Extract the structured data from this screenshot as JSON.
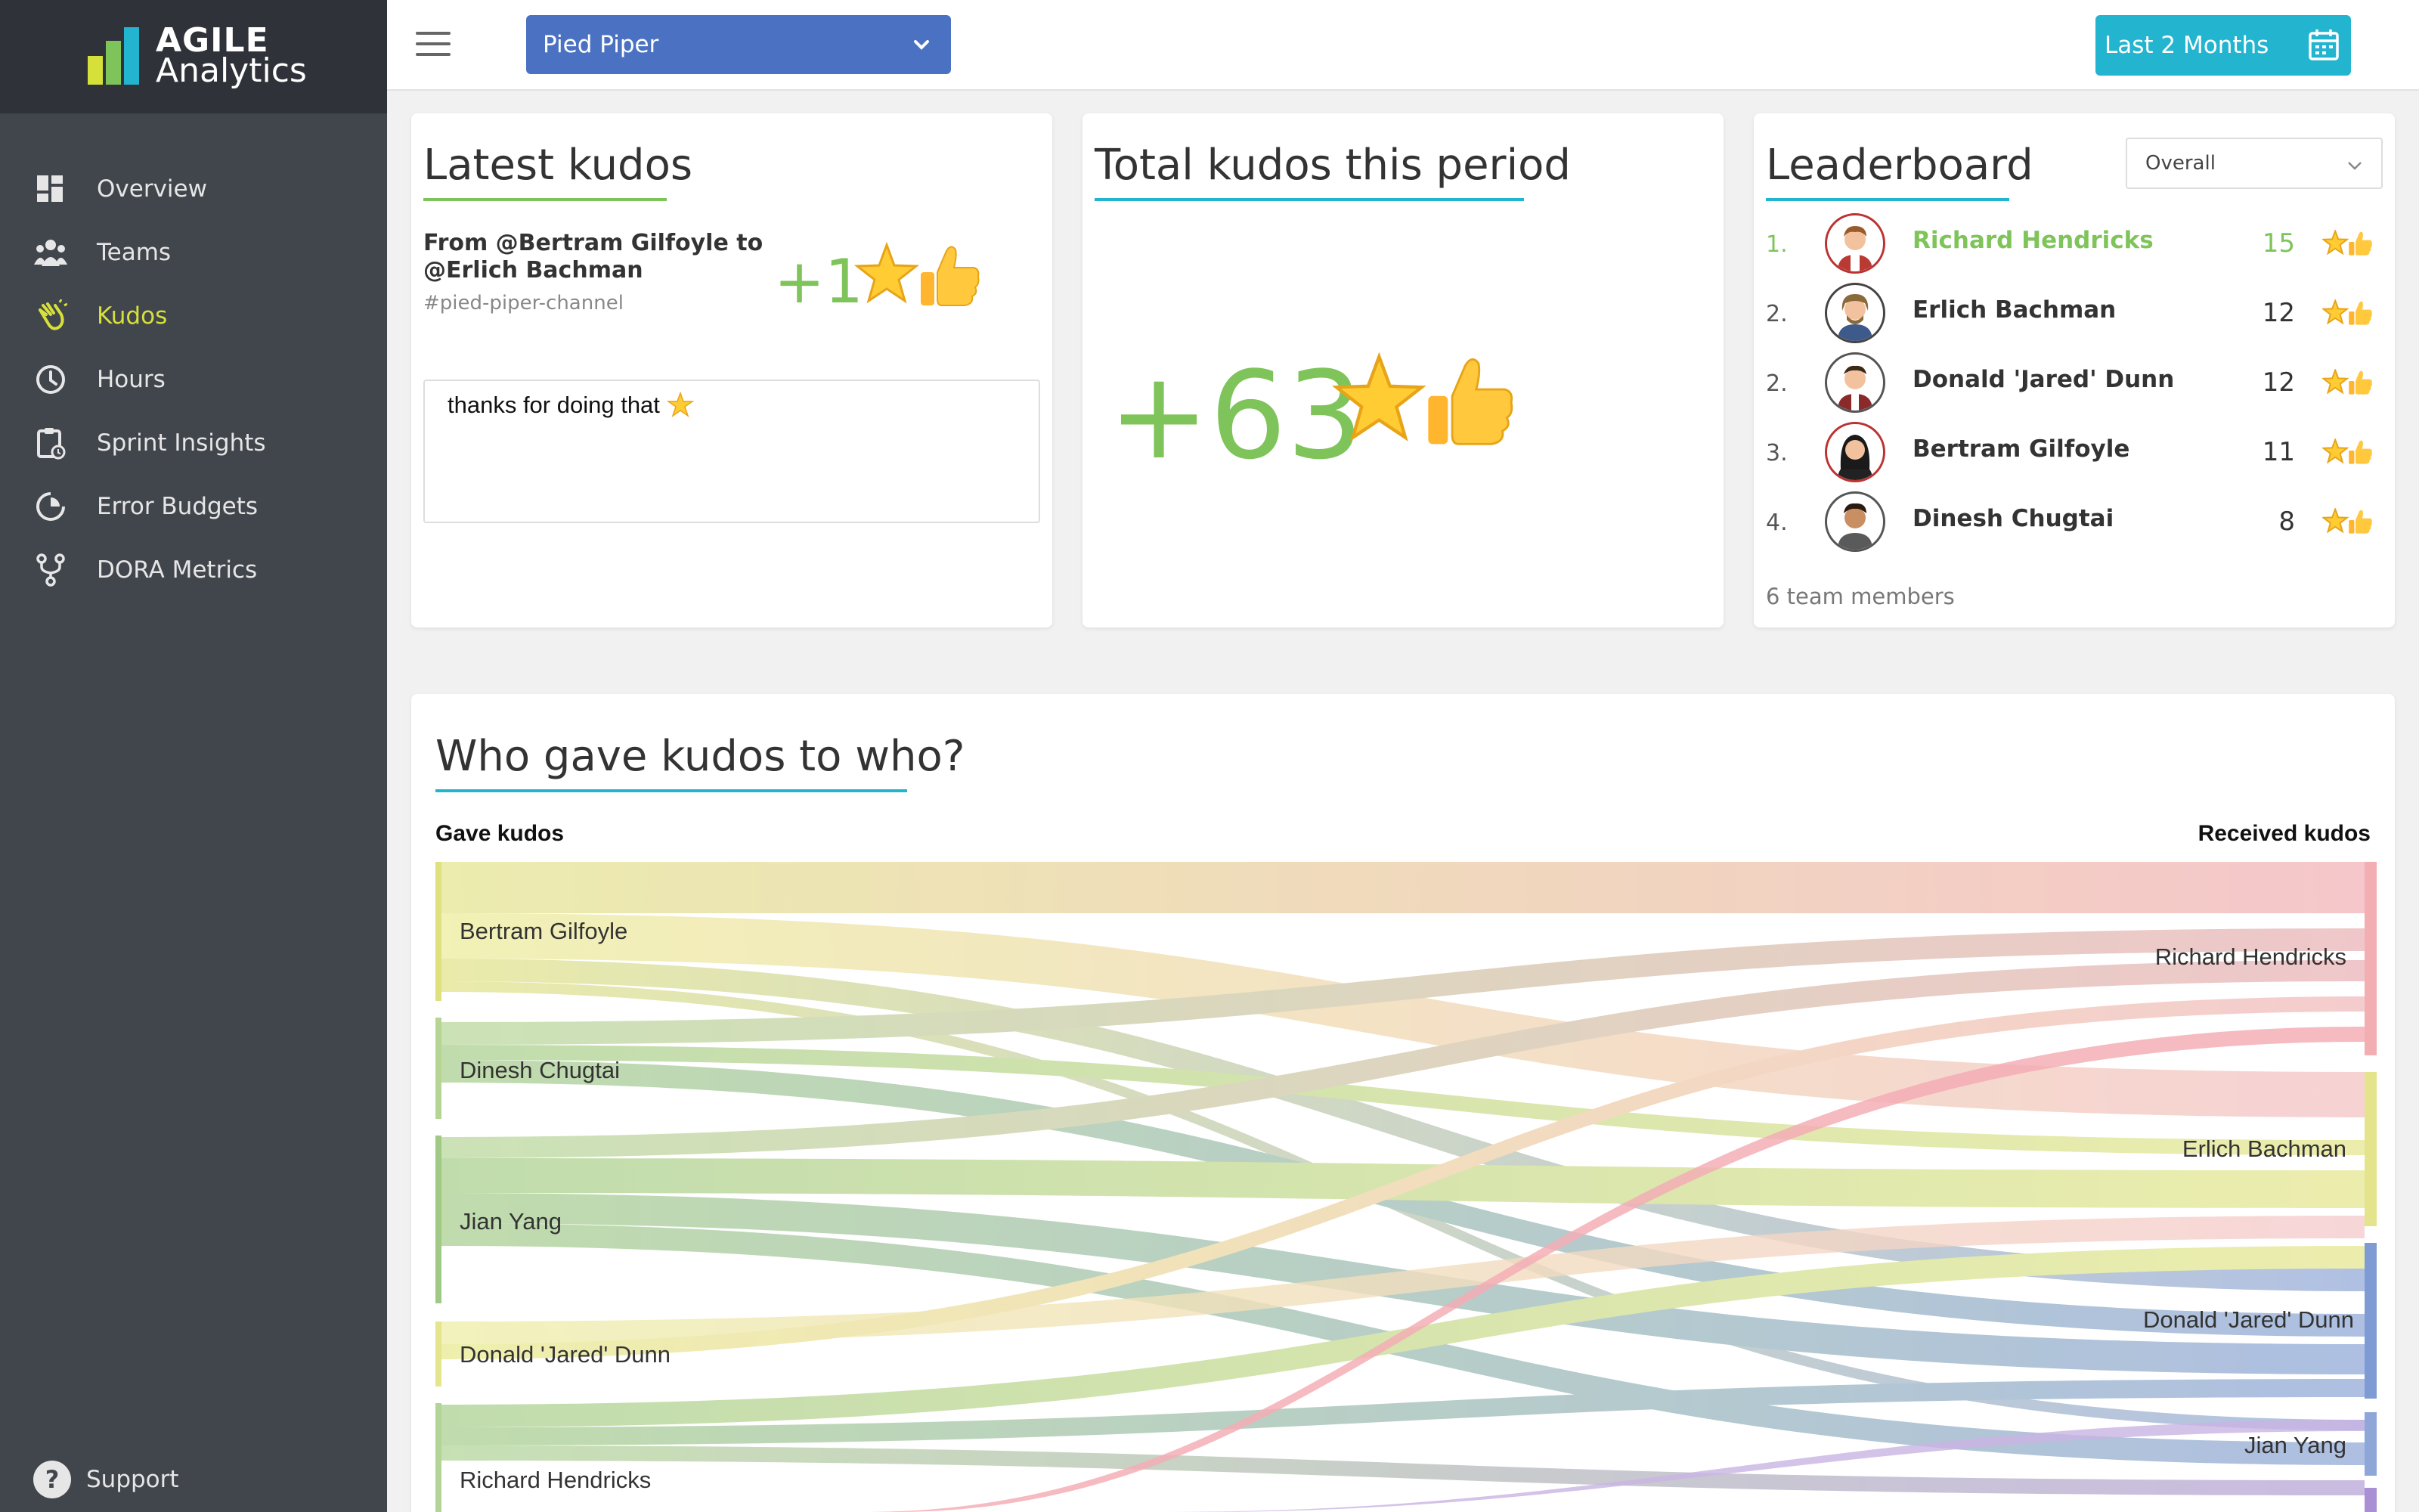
{
  "app": {
    "logo_line1": "AGILE",
    "logo_line2": "Analytics",
    "brand_colors": [
      "#7fc45a",
      "#d6e03a",
      "#23b5cf"
    ]
  },
  "sidebar": {
    "items": [
      {
        "label": "Overview",
        "icon": "dashboard-icon",
        "active": false
      },
      {
        "label": "Teams",
        "icon": "teams-icon",
        "active": false
      },
      {
        "label": "Kudos",
        "icon": "clap-icon",
        "active": true
      },
      {
        "label": "Hours",
        "icon": "clock-icon",
        "active": false
      },
      {
        "label": "Sprint Insights",
        "icon": "clipboard-icon",
        "active": false
      },
      {
        "label": "Error Budgets",
        "icon": "gauge-icon",
        "active": false
      },
      {
        "label": "DORA Metrics",
        "icon": "fork-icon",
        "active": false
      }
    ],
    "support_label": "Support"
  },
  "topbar": {
    "project": "Pied Piper",
    "period": "Last 2 Months"
  },
  "latest_kudos": {
    "title": "Latest kudos",
    "from_line": "From @Bertram Gilfoyle to @Erlich Bachman",
    "channel": "#pied-piper-channel",
    "amount": "+1",
    "message": "thanks for doing that"
  },
  "total_kudos": {
    "title": "Total kudos this period",
    "value": "+63"
  },
  "leaderboard": {
    "title": "Leaderboard",
    "filter": "Overall",
    "rows": [
      {
        "rank": "1.",
        "name": "Richard Hendricks",
        "count": "15"
      },
      {
        "rank": "2.",
        "name": "Erlich Bachman",
        "count": "12"
      },
      {
        "rank": "2.",
        "name": "Donald 'Jared' Dunn",
        "count": "12"
      },
      {
        "rank": "3.",
        "name": "Bertram Gilfoyle",
        "count": "11"
      },
      {
        "rank": "4.",
        "name": "Dinesh Chugtai",
        "count": "8"
      }
    ],
    "footer": "6 team members"
  },
  "sankey": {
    "title": "Who gave kudos to who?",
    "left_header": "Gave kudos",
    "right_header": "Received kudos",
    "givers": [
      "Bertram Gilfoyle",
      "Dinesh Chugtai",
      "Jian Yang",
      "Donald 'Jared' Dunn",
      "Richard Hendricks"
    ],
    "receivers": [
      "Richard Hendricks",
      "Erlich Bachman",
      "Donald 'Jared' Dunn",
      "Jian Yang"
    ]
  }
}
